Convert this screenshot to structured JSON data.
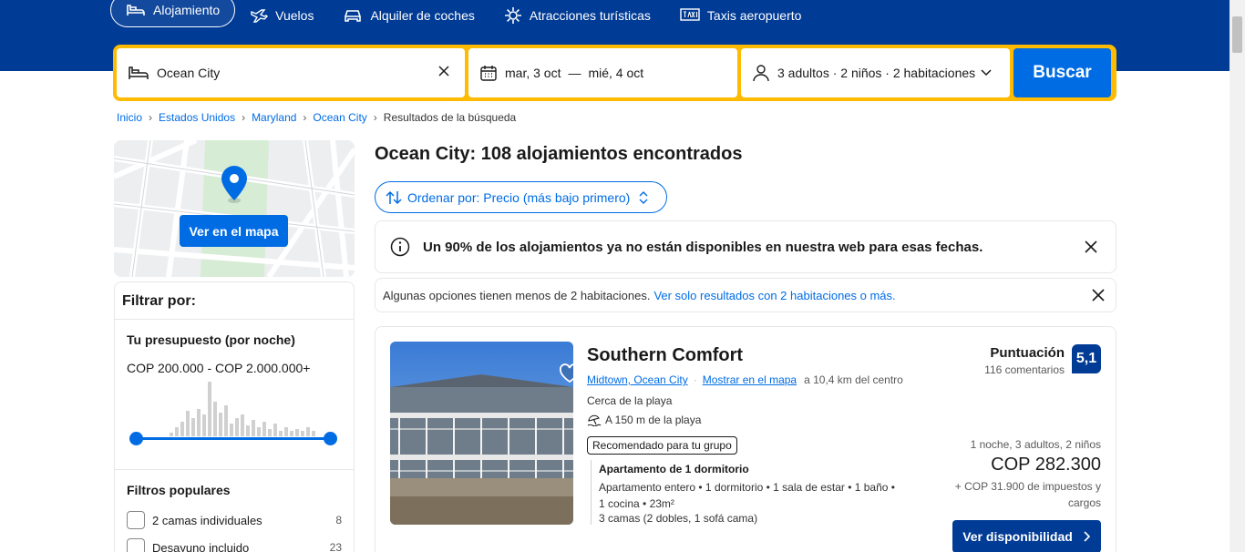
{
  "nav": {
    "items": [
      {
        "label": "Alojamiento",
        "icon": "bed-icon",
        "active": true
      },
      {
        "label": "Vuelos",
        "icon": "plane-icon"
      },
      {
        "label": "Alquiler de coches",
        "icon": "car-icon"
      },
      {
        "label": "Atracciones turísticas",
        "icon": "attractions-icon"
      },
      {
        "label": "Taxis aeropuerto",
        "icon": "taxi-icon"
      }
    ]
  },
  "search": {
    "destination": "Ocean City",
    "date_from": "mar, 3 oct",
    "date_sep": "—",
    "date_to": "mié, 4 oct",
    "guests": "3 adultos · 2 niños · 2 habitaciones",
    "button": "Buscar"
  },
  "breadcrumb": [
    "Inicio",
    "Estados Unidos",
    "Maryland",
    "Ocean City",
    "Resultados de la búsqueda"
  ],
  "map": {
    "button": "Ver en el mapa"
  },
  "filters": {
    "title": "Filtrar por:",
    "budget_title": "Tu presupuesto (por noche)",
    "budget_range": "COP 200.000 - COP 2.000.000+",
    "popular_title": "Filtros populares",
    "popular": [
      {
        "label": "2 camas individuales",
        "count": "8"
      },
      {
        "label": "Desayuno incluido",
        "count": "23"
      }
    ]
  },
  "results": {
    "title": "Ocean City: 108 alojamientos encontrados",
    "sort_label": "Ordenar por: Precio (más bajo primero)",
    "alert_main": "Un 90% de los alojamientos ya no están disponibles en nuestra web para esas fechas.",
    "alert_rooms_text": "Algunas opciones tienen menos de 2 habitaciones.",
    "alert_rooms_link": "Ver solo resultados con 2 habitaciones o más."
  },
  "card": {
    "name": "Southern Comfort",
    "area_link": "Midtown, Ocean City",
    "map_link": "Mostrar en el mapa",
    "distance": "a 10,4 km del centro",
    "near": "Cerca de la playa",
    "beach": "A 150 m de la playa",
    "badge": "Recomendado para tu grupo",
    "unit_title": "Apartamento de 1 dormitorio",
    "unit_desc": "Apartamento entero • 1 dormitorio • 1 sala de estar • 1 baño • 1 cocina • 23m²",
    "unit_beds": "3 camas (2 dobles, 1 sofá cama)",
    "score_label": "Puntuación",
    "score_count": "116 comentarios",
    "score": "5,1",
    "price_meta": "1 noche, 3 adultos, 2 niños",
    "price": "COP 282.300",
    "taxes": "+ COP 31.900 de impuestos y cargos",
    "avail_button": "Ver disponibilidad"
  },
  "colors": {
    "brand": "#003b95",
    "accent": "#006ce4",
    "searchbar": "#febb02"
  }
}
